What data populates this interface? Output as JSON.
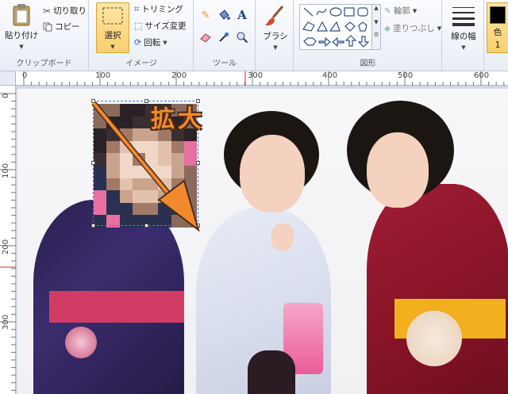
{
  "ribbon": {
    "clipboard": {
      "paste_label": "貼り付け",
      "cut_label": "切り取り",
      "copy_label": "コピー",
      "group_label": "クリップボード"
    },
    "image": {
      "select_label": "選択",
      "crop_label": "トリミング",
      "resize_label": "サイズ変更",
      "rotate_label": "回転",
      "group_label": "イメージ"
    },
    "tools": {
      "group_label": "ツール",
      "text_tool_glyph": "A"
    },
    "brush": {
      "brush_label": "ブラシ"
    },
    "shapes": {
      "outline_label": "輪郭",
      "fill_label": "塗りつぶし",
      "group_label": "図形"
    },
    "size": {
      "size_label": "線の幅"
    },
    "color": {
      "color_label": "色",
      "color_index": "1"
    }
  },
  "ruler": {
    "h_ticks": [
      "0",
      "100",
      "200",
      "300",
      "400",
      "500",
      "600"
    ],
    "v_ticks": [
      "0",
      "100",
      "200",
      "300"
    ]
  },
  "canvas": {
    "annotation_text": "拡大"
  },
  "colors": {
    "selected_tool_bg": "#f8cf6d",
    "annotation_fill": "#f08a2c",
    "annotation_stroke": "#4a2a1a",
    "selection_border": "#3a7bd5"
  }
}
